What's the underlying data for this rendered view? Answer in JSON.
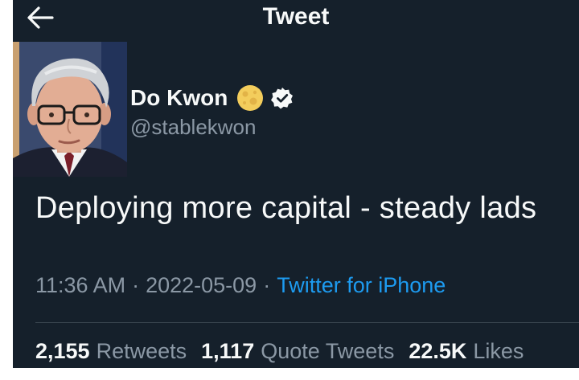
{
  "header": {
    "title": "Tweet",
    "back_icon": "arrow-left-icon"
  },
  "author": {
    "display_name": "Do Kwon",
    "handle": "@stablekwon",
    "emoji_icon": "full-moon-icon",
    "verified_icon": "verified-badge-icon"
  },
  "tweet": {
    "text": "Deploying more capital - steady lads",
    "time": "11:36 AM",
    "date": "2022-05-09",
    "source": "Twitter for iPhone",
    "separator": "·"
  },
  "stats": [
    {
      "count": "2,155",
      "label": "Retweets"
    },
    {
      "count": "1,117",
      "label": "Quote Tweets"
    },
    {
      "count": "22.5K",
      "label": "Likes"
    }
  ],
  "colors": {
    "background": "#15202b",
    "text_primary": "#f7f9f9",
    "text_secondary": "#8b98a5",
    "link": "#1d9bf0",
    "divider": "#38444d"
  }
}
